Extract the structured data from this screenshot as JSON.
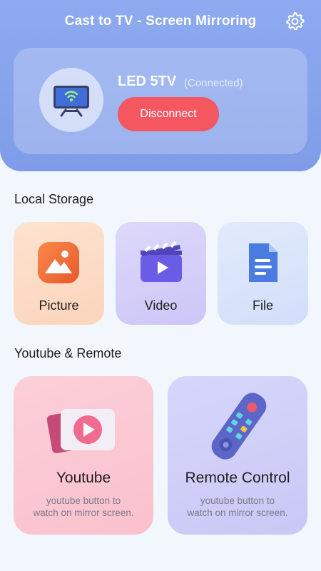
{
  "header": {
    "title": "Cast to TV - Screen Mirroring",
    "settings_icon": "gear-icon"
  },
  "device": {
    "name": "LED 5TV",
    "status": "(Connected)",
    "disconnect_label": "Disconnect",
    "icon": "tv-wifi-icon"
  },
  "local_storage": {
    "title": "Local Storage",
    "items": [
      {
        "label": "Picture",
        "icon": "picture-icon"
      },
      {
        "label": "Video",
        "icon": "video-clapper-icon"
      },
      {
        "label": "File",
        "icon": "file-icon"
      }
    ]
  },
  "youtube_remote": {
    "title": "Youtube & Remote",
    "cards": [
      {
        "title": "Youtube",
        "desc_line1": "youtube button to",
        "desc_line2": "watch on mirror screen.",
        "icon": "youtube-play-icon"
      },
      {
        "title": "Remote Control",
        "desc_line1": "youtube button to",
        "desc_line2": "watch on mirror screen.",
        "icon": "remote-control-icon"
      }
    ]
  },
  "colors": {
    "header_bg": "#8eaaf0",
    "disconnect_bg": "#f4575f",
    "picture_tile": "#fde3cf",
    "video_tile": "#ddd8fb",
    "file_tile": "#e2eafb",
    "youtube_card": "#fccfd8",
    "remote_card": "#d6d6fb"
  }
}
